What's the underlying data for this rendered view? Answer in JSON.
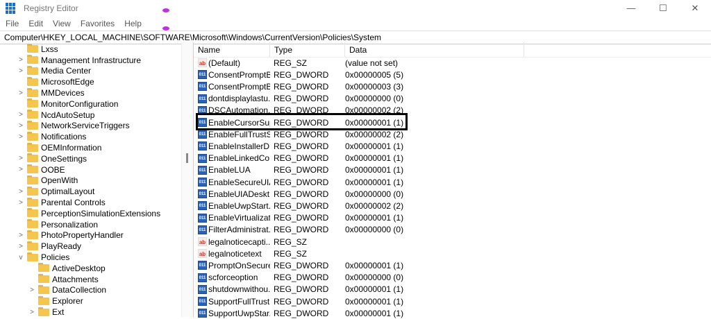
{
  "window": {
    "title": "Registry Editor",
    "controls": [
      "—",
      "☐",
      "✕"
    ]
  },
  "menu": [
    "File",
    "Edit",
    "View",
    "Favorites",
    "Help"
  ],
  "address": "Computer\\HKEY_LOCAL_MACHINE\\SOFTWARE\\Microsoft\\Windows\\CurrentVersion\\Policies\\System",
  "tree": [
    {
      "label": "Lxss",
      "chev": "",
      "indent": 0
    },
    {
      "label": "Management Infrastructure",
      "chev": ">",
      "indent": 0
    },
    {
      "label": "Media Center",
      "chev": ">",
      "indent": 0
    },
    {
      "label": "MicrosoftEdge",
      "chev": "",
      "indent": 0
    },
    {
      "label": "MMDevices",
      "chev": ">",
      "indent": 0
    },
    {
      "label": "MonitorConfiguration",
      "chev": "",
      "indent": 0
    },
    {
      "label": "NcdAutoSetup",
      "chev": ">",
      "indent": 0
    },
    {
      "label": "NetworkServiceTriggers",
      "chev": ">",
      "indent": 0
    },
    {
      "label": "Notifications",
      "chev": ">",
      "indent": 0
    },
    {
      "label": "OEMInformation",
      "chev": "",
      "indent": 0
    },
    {
      "label": "OneSettings",
      "chev": ">",
      "indent": 0
    },
    {
      "label": "OOBE",
      "chev": ">",
      "indent": 0
    },
    {
      "label": "OpenWith",
      "chev": "",
      "indent": 0
    },
    {
      "label": "OptimalLayout",
      "chev": ">",
      "indent": 0
    },
    {
      "label": "Parental Controls",
      "chev": ">",
      "indent": 0
    },
    {
      "label": "PerceptionSimulationExtensions",
      "chev": "",
      "indent": 0
    },
    {
      "label": "Personalization",
      "chev": "",
      "indent": 0
    },
    {
      "label": "PhotoPropertyHandler",
      "chev": ">",
      "indent": 0
    },
    {
      "label": "PlayReady",
      "chev": ">",
      "indent": 0
    },
    {
      "label": "Policies",
      "chev": "v",
      "indent": 0
    },
    {
      "label": "ActiveDesktop",
      "chev": "",
      "indent": 1
    },
    {
      "label": "Attachments",
      "chev": "",
      "indent": 1
    },
    {
      "label": "DataCollection",
      "chev": ">",
      "indent": 1
    },
    {
      "label": "Explorer",
      "chev": "",
      "indent": 1
    },
    {
      "label": "Ext",
      "chev": ">",
      "indent": 1
    }
  ],
  "columns": [
    "Name",
    "Type",
    "Data"
  ],
  "values": [
    {
      "name": "(Default)",
      "type": "REG_SZ",
      "data": "(value not set)",
      "icon": "sz"
    },
    {
      "name": "ConsentPromptB...",
      "type": "REG_DWORD",
      "data": "0x00000005 (5)",
      "icon": "bin"
    },
    {
      "name": "ConsentPromptB...",
      "type": "REG_DWORD",
      "data": "0x00000003 (3)",
      "icon": "bin"
    },
    {
      "name": "dontdisplaylastu...",
      "type": "REG_DWORD",
      "data": "0x00000000 (0)",
      "icon": "bin"
    },
    {
      "name": "DSCAutomation...",
      "type": "REG_DWORD",
      "data": "0x00000002 (2)",
      "icon": "bin"
    },
    {
      "name": "EnableCursorSup...",
      "type": "REG_DWORD",
      "data": "0x00000001 (1)",
      "icon": "bin"
    },
    {
      "name": "EnableFullTrustSt...",
      "type": "REG_DWORD",
      "data": "0x00000002 (2)",
      "icon": "bin"
    },
    {
      "name": "EnableInstallerD...",
      "type": "REG_DWORD",
      "data": "0x00000001 (1)",
      "icon": "bin"
    },
    {
      "name": "EnableLinkedCo...",
      "type": "REG_DWORD",
      "data": "0x00000001 (1)",
      "icon": "bin"
    },
    {
      "name": "EnableLUA",
      "type": "REG_DWORD",
      "data": "0x00000001 (1)",
      "icon": "bin"
    },
    {
      "name": "EnableSecureUIA...",
      "type": "REG_DWORD",
      "data": "0x00000001 (1)",
      "icon": "bin"
    },
    {
      "name": "EnableUIADeskt...",
      "type": "REG_DWORD",
      "data": "0x00000000 (0)",
      "icon": "bin"
    },
    {
      "name": "EnableUwpStart...",
      "type": "REG_DWORD",
      "data": "0x00000002 (2)",
      "icon": "bin"
    },
    {
      "name": "EnableVirtualizat...",
      "type": "REG_DWORD",
      "data": "0x00000001 (1)",
      "icon": "bin"
    },
    {
      "name": "FilterAdministrat...",
      "type": "REG_DWORD",
      "data": "0x00000000 (0)",
      "icon": "bin"
    },
    {
      "name": "legalnoticecapti...",
      "type": "REG_SZ",
      "data": "",
      "icon": "sz"
    },
    {
      "name": "legalnoticetext",
      "type": "REG_SZ",
      "data": "",
      "icon": "sz"
    },
    {
      "name": "PromptOnSecure...",
      "type": "REG_DWORD",
      "data": "0x00000001 (1)",
      "icon": "bin"
    },
    {
      "name": "scforceoption",
      "type": "REG_DWORD",
      "data": "0x00000000 (0)",
      "icon": "bin"
    },
    {
      "name": "shutdownwithou...",
      "type": "REG_DWORD",
      "data": "0x00000001 (1)",
      "icon": "bin"
    },
    {
      "name": "SupportFullTrust...",
      "type": "REG_DWORD",
      "data": "0x00000001 (1)",
      "icon": "bin"
    },
    {
      "name": "SupportUwpStar...",
      "type": "REG_DWORD",
      "data": "0x00000001 (1)",
      "icon": "bin"
    }
  ],
  "highlighted_row": 5
}
